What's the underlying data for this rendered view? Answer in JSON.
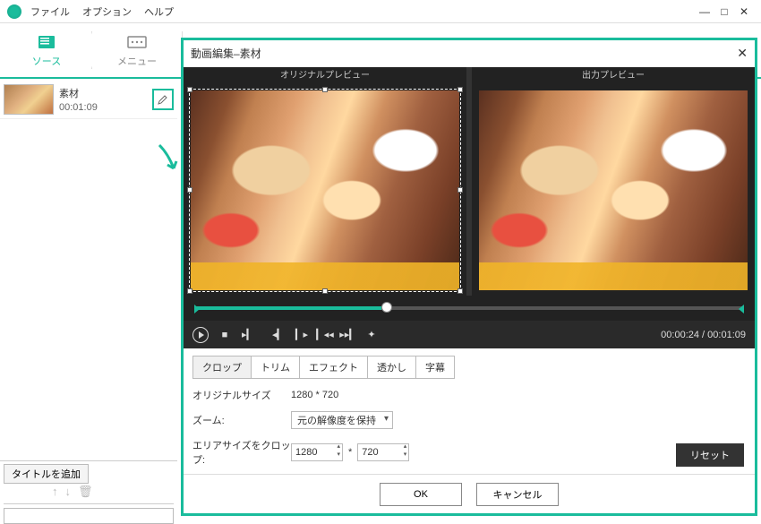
{
  "menubar": {
    "file": "ファイル",
    "options": "オプション",
    "help": "ヘルプ"
  },
  "window": {
    "min": "—",
    "max": "□",
    "close": "✕"
  },
  "tabs": {
    "source": "ソース",
    "menu": "メニュー"
  },
  "clip": {
    "name": "素材",
    "duration": "00:01:09"
  },
  "bottom": {
    "add_title": "タイトルを追加"
  },
  "dialog": {
    "title": "動画編集–素材",
    "original_preview": "オリジナルプレビュー",
    "output_preview": "出力プレビュー",
    "time_current": "00:00:24",
    "time_total": "00:01:09",
    "tabs": {
      "crop": "クロップ",
      "trim": "トリム",
      "effect": "エフェクト",
      "watermark": "透かし",
      "subtitle": "字幕"
    },
    "orig_size_label": "オリジナルサイズ",
    "orig_size_value": "1280 * 720",
    "zoom_label": "ズーム:",
    "zoom_value": "元の解像度を保持",
    "crop_area_label": "エリアサイズをクロップ:",
    "crop_w": "1280",
    "crop_h": "720",
    "reset": "リセット",
    "ok": "OK",
    "cancel": "キャンセル"
  }
}
